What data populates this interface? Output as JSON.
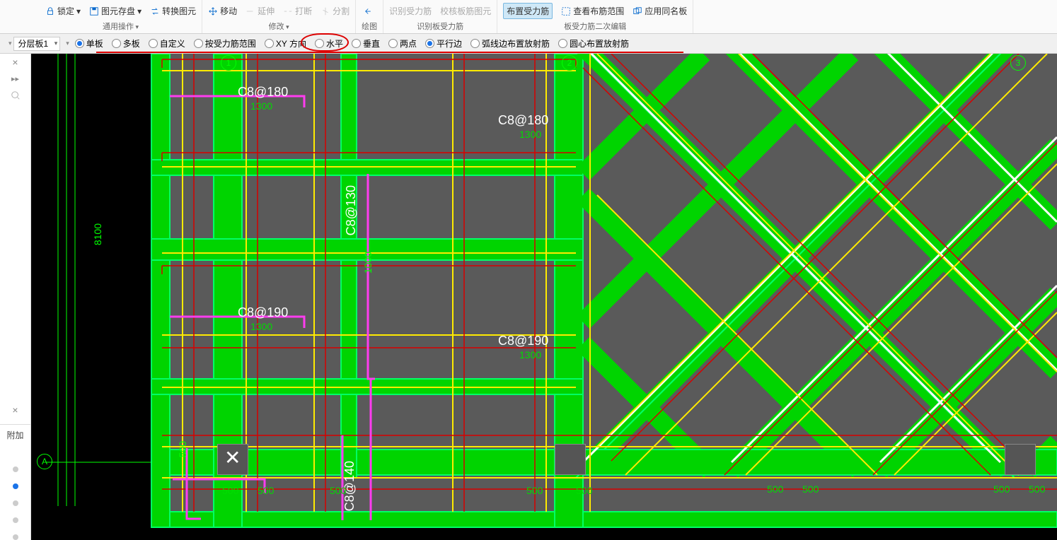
{
  "ribbon": {
    "lock": "锁定",
    "cache": "图元存盘",
    "convert": "转换图元",
    "move": "移动",
    "extend": "延伸",
    "break": "打断",
    "split": "分割",
    "draw": "绘图",
    "recognize_label": "识别受力筋",
    "view_range": "查看布筋范围",
    "apply_same": "应用同名板",
    "place_rebar": "布置受力筋",
    "check_drawing": "校核板筋图元",
    "group_common": "通用操作",
    "group_modify": "修改",
    "group_draw": "绘图",
    "group_recognize": "识别板受力筋",
    "group_rebar_edit": "板受力筋二次编辑"
  },
  "options": {
    "combo_value": "分层板1",
    "radios": [
      {
        "label": "单板",
        "checked": true
      },
      {
        "label": "多板",
        "checked": false
      },
      {
        "label": "自定义",
        "checked": false
      },
      {
        "label": "按受力筋范围",
        "checked": false
      },
      {
        "label": "XY 方向",
        "checked": false
      },
      {
        "label": "水平",
        "checked": false
      },
      {
        "label": "垂直",
        "checked": false
      },
      {
        "label": "两点",
        "checked": false
      },
      {
        "label": "平行边",
        "checked": true
      },
      {
        "label": "弧线边布置放射筋",
        "checked": false
      },
      {
        "label": "圆心布置放射筋",
        "checked": false
      }
    ]
  },
  "side": {
    "expand": "▸▸",
    "attach": "附加"
  },
  "canvas": {
    "axis1": "1",
    "axis2": "2",
    "axis3": "3",
    "axisA": "A",
    "dim8100": "8100",
    "labels": {
      "c8_180_1": "C8@180",
      "c8_180_2": "C8@180",
      "c8_130": "C8@130",
      "c8_190_1": "C8@190",
      "c8_190_2": "C8@190",
      "c8_140": "C8@140"
    },
    "dim1300a": "1300",
    "dim1300b": "1300",
    "dim1300c": "1300",
    "dim1300d": "1300",
    "dim1000": "1000",
    "dim500a": "500",
    "dim500b": "500",
    "dim500c": "500",
    "dim500d": "500",
    "dim500e": "500",
    "dim500f": "500",
    "dim500g": "500",
    "dim500h": "500"
  }
}
